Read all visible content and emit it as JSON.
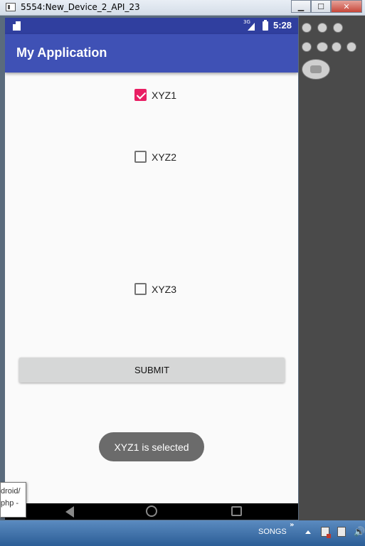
{
  "window": {
    "title": "5554:New_Device_2_API_23",
    "minimize_label": "▁",
    "maximize_label": "☐",
    "close_label": "✕"
  },
  "status_bar": {
    "network": "3G",
    "time": "5:28"
  },
  "app": {
    "title": "My Application"
  },
  "checkboxes": [
    {
      "label": "XYZ1",
      "checked": true
    },
    {
      "label": "XYZ2",
      "checked": false
    },
    {
      "label": "XYZ3",
      "checked": false
    }
  ],
  "submit_label": "SUBMIT",
  "toast": "XYZ1 is selected",
  "tooltip": {
    "line1": "droid/",
    "line2": "php -"
  },
  "taskbar": {
    "toolbar_label": "SONGS",
    "chevron": "»",
    "volume_glyph": "🔊"
  },
  "icons": {
    "app": "app-icon",
    "sd_card": "sd-card-icon",
    "signal": "signal-icon",
    "battery": "battery-icon",
    "back": "back-icon",
    "home": "home-icon",
    "recents": "recents-icon"
  },
  "colors": {
    "status_bar": "#303f9f",
    "app_bar": "#3f51b5",
    "checkbox_accent": "#e91e63",
    "toast_bg": "#6b6b6b"
  }
}
